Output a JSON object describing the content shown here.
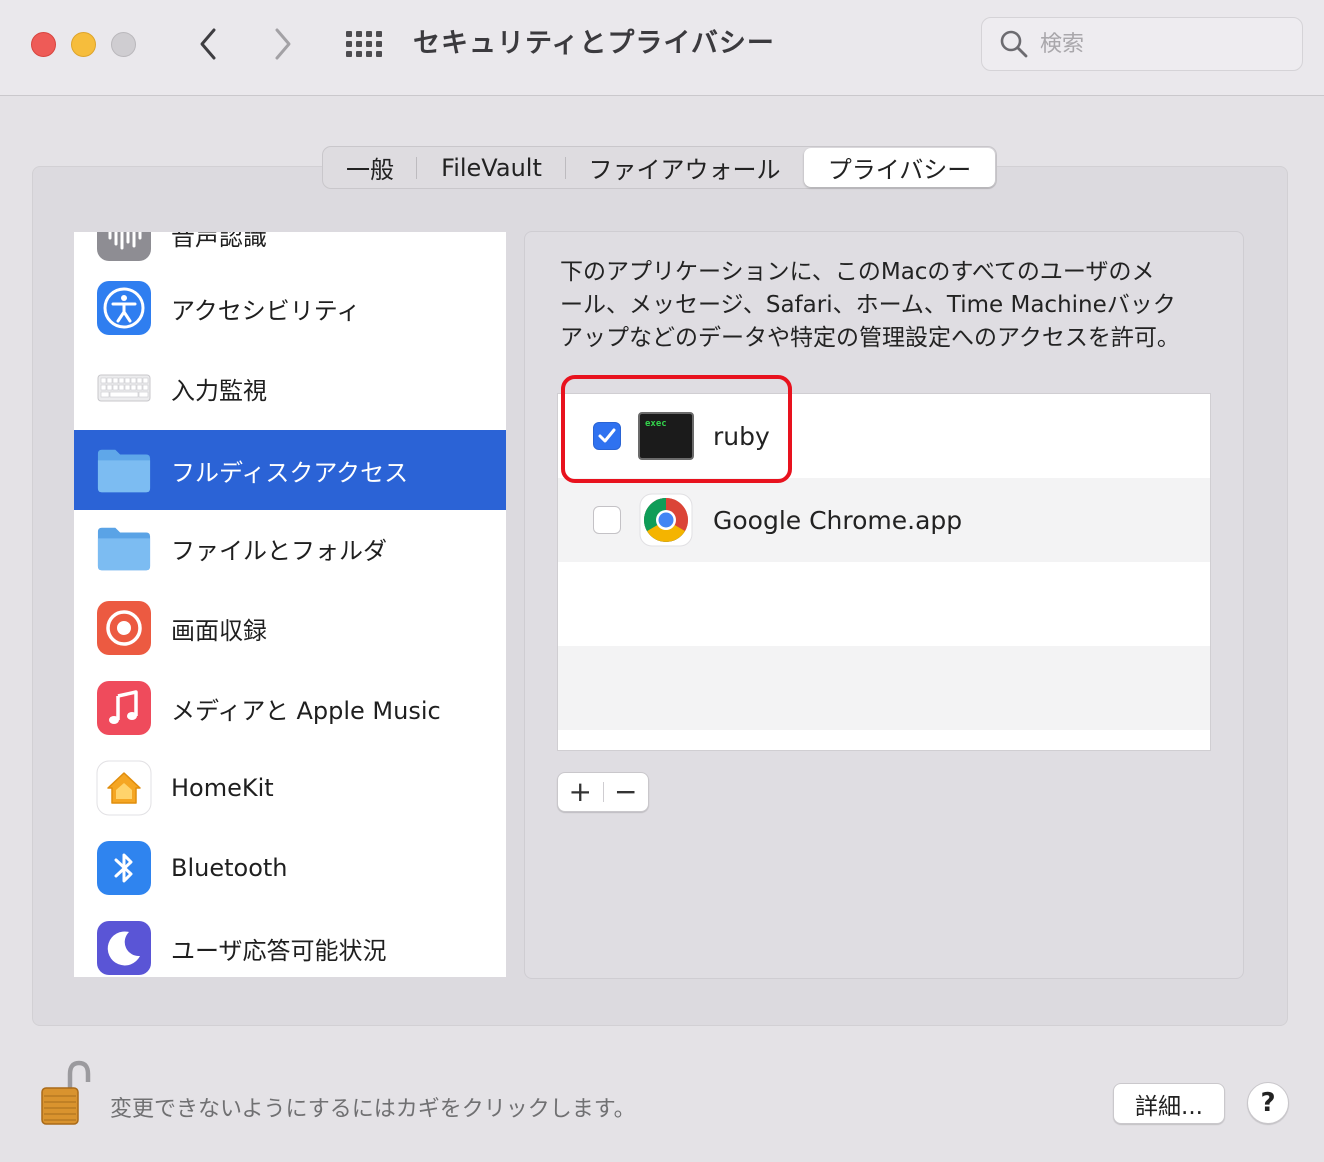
{
  "window": {
    "title": "セキュリティとプライバシー"
  },
  "search": {
    "placeholder": "検索",
    "value": ""
  },
  "tabs": [
    {
      "label": "一般",
      "active": false
    },
    {
      "label": "FileVault",
      "active": false
    },
    {
      "label": "ファイアウォール",
      "active": false
    },
    {
      "label": "プライバシー",
      "active": true
    }
  ],
  "sidebar": {
    "items": [
      {
        "label": "音声認識",
        "icon": "waveform-icon",
        "selected": false
      },
      {
        "label": "アクセシビリティ",
        "icon": "accessibility-icon",
        "selected": false
      },
      {
        "label": "入力監視",
        "icon": "keyboard-icon",
        "selected": false
      },
      {
        "label": "フルディスクアクセス",
        "icon": "folder-icon",
        "selected": true
      },
      {
        "label": "ファイルとフォルダ",
        "icon": "folder-icon",
        "selected": false
      },
      {
        "label": "画面収録",
        "icon": "screen-record-icon",
        "selected": false
      },
      {
        "label": "メディアと Apple Music",
        "icon": "music-note-icon",
        "selected": false
      },
      {
        "label": "HomeKit",
        "icon": "home-icon",
        "selected": false
      },
      {
        "label": "Bluetooth",
        "icon": "bluetooth-icon",
        "selected": false
      },
      {
        "label": "ユーザ応答可能状況",
        "icon": "moon-icon",
        "selected": false
      }
    ]
  },
  "detail": {
    "description_lines": [
      "下のアプリケーションに、このMacのすべてのユーザのメ",
      "ール、メッセージ、Safari、ホーム、Time Machineバック",
      "アップなどのデータや特定の管理設定へのアクセスを許可。"
    ],
    "apps": [
      {
        "name": "ruby",
        "checked": true,
        "icon": "terminal-exec-icon",
        "icon_text": "exec"
      },
      {
        "name": "Google Chrome.app",
        "checked": false,
        "icon": "chrome-icon"
      }
    ],
    "add_label": "+",
    "remove_label": "−"
  },
  "footer": {
    "lock_text": "変更できないようにするにはカギをクリックします。",
    "advanced_label": "詳細...",
    "help_label": "?"
  },
  "colors": {
    "accent": "#2b63d6",
    "highlight_box": "#e8121e",
    "close": "#ee5b57",
    "minimize": "#f6bd3c"
  }
}
